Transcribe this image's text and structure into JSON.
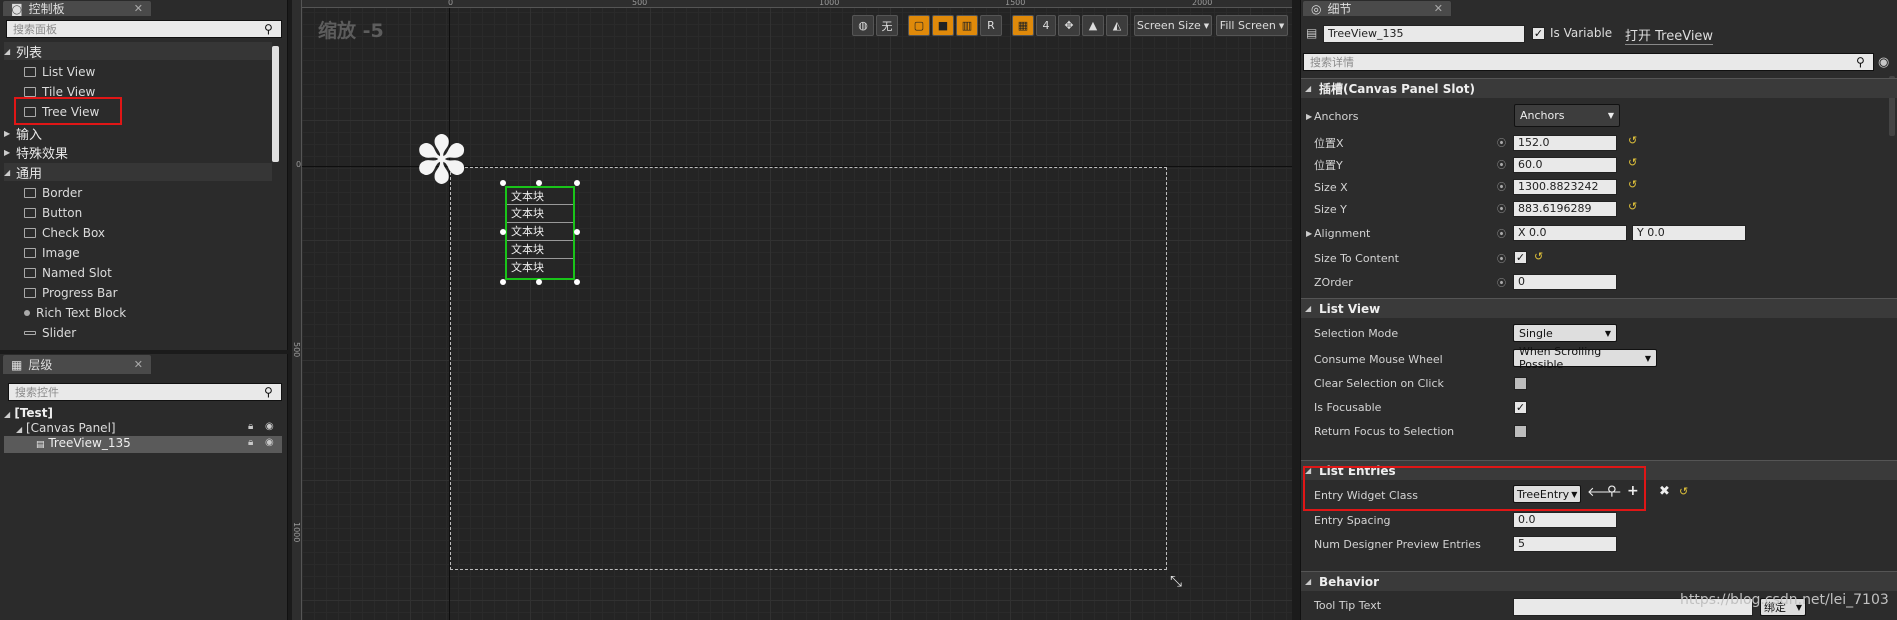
{
  "palette": {
    "tabs": {
      "title": "控制板"
    },
    "search_placeholder": "搜索面板",
    "categories": [
      {
        "label": "列表",
        "items": [
          "List View",
          "Tile View",
          "Tree View"
        ]
      },
      {
        "label": "输入"
      },
      {
        "label": "特殊效果"
      },
      {
        "label": "通用",
        "items": [
          "Border",
          "Button",
          "Check Box",
          "Image",
          "Named Slot",
          "Progress Bar",
          "Rich Text Block",
          "Slider"
        ]
      }
    ]
  },
  "hierarchy": {
    "tab_title": "层级",
    "search_placeholder": "搜索控件",
    "nodes": [
      "[Test]",
      "[Canvas Panel]",
      "TreeView_135"
    ]
  },
  "viewport": {
    "zoom_label": "缩放 -5",
    "toolbar": {
      "none_label": "无",
      "r_label": "R",
      "grid_value": "4",
      "screen_size": "Screen Size",
      "fill_screen": "Fill Screen"
    },
    "ruler_top": [
      "0",
      "500",
      "1000",
      "1500",
      "2000"
    ],
    "ruler_left": [
      "0",
      "500",
      "1000"
    ],
    "text_blocks": [
      "文本块",
      "文本块",
      "文本块",
      "文本块",
      "文本块"
    ]
  },
  "details": {
    "tab_title": "细节",
    "widget_name": "TreeView_135",
    "is_variable_label": "Is Variable",
    "open_link": "打开 TreeView",
    "search_placeholder": "搜索详情",
    "sections": {
      "slot": "插槽(Canvas Panel Slot)",
      "list_view": "List View",
      "list_entries": "List Entries",
      "behavior": "Behavior"
    },
    "slot_props": {
      "anchors_label": "Anchors",
      "anchors_value": "Anchors",
      "pos_x_label": "位置X",
      "pos_x": "152.0",
      "pos_y_label": "位置Y",
      "pos_y": "60.0",
      "size_x_label": "Size X",
      "size_x": "1300.8823242",
      "size_y_label": "Size Y",
      "size_y": "883.6196289",
      "alignment_label": "Alignment",
      "align_x": "X  0.0",
      "align_y": "Y  0.0",
      "size_to_content_label": "Size To Content",
      "zorder_label": "ZOrder",
      "zorder": "0"
    },
    "list_props": {
      "selection_mode_label": "Selection Mode",
      "selection_mode": "Single",
      "consume_wheel_label": "Consume Mouse Wheel",
      "consume_wheel": "When Scrolling Possible",
      "clear_selection_label": "Clear Selection on Click",
      "focusable_label": "Is Focusable",
      "return_focus_label": "Return Focus to Selection"
    },
    "entry_props": {
      "entry_class_label": "Entry Widget Class",
      "entry_class": "TreeEntry",
      "entry_spacing_label": "Entry Spacing",
      "entry_spacing": "0.0",
      "num_preview_label": "Num Designer Preview Entries",
      "num_preview": "5"
    },
    "behavior_props": {
      "tooltip_label": "Tool Tip Text",
      "tooltip_button": "绑定"
    }
  },
  "watermark": "https://blog.csdn.net/lei_7103"
}
